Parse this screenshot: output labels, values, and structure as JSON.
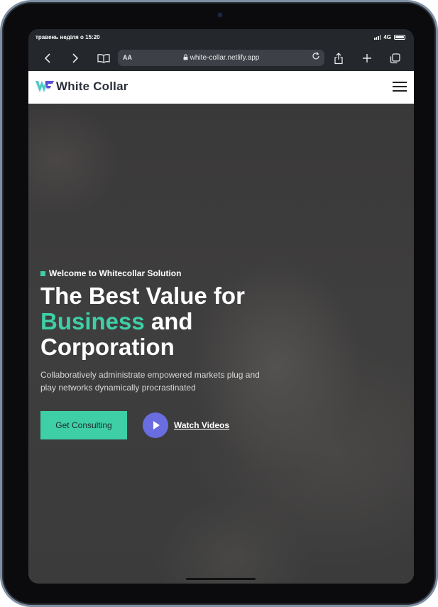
{
  "status_bar": {
    "time": "травень неділя о 15:20",
    "network": "4G"
  },
  "browser": {
    "text_size_label": "AA",
    "url": "white-collar.netlify.app"
  },
  "site": {
    "brand": "White Collar",
    "hero": {
      "eyebrow": "Welcome to Whitecollar Solution",
      "headline_line1": "The Best Value for",
      "headline_accent": "Business",
      "headline_rest": "and",
      "headline_line3": "Corporation",
      "description": "Collaboratively administrate empowered markets plug and play networks dynamically procrastinated",
      "primary_cta": "Get Consulting",
      "video_cta": "Watch Videos"
    }
  },
  "colors": {
    "accent": "#3ecfa6",
    "play": "#6a6de0",
    "logo_blue": "#5b4fd6"
  },
  "icons": [
    "back-icon",
    "forward-icon",
    "bookmarks-icon",
    "lock-icon",
    "reload-icon",
    "share-icon",
    "new-tab-icon",
    "tabs-icon",
    "menu-icon",
    "play-icon"
  ]
}
